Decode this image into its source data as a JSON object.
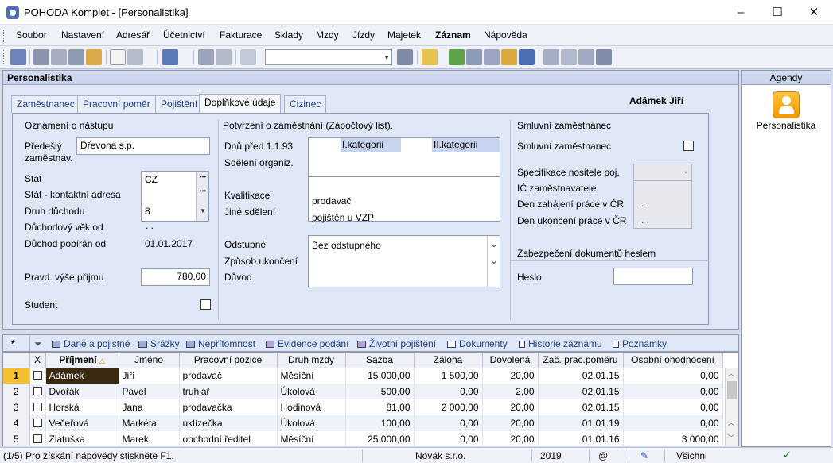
{
  "window": {
    "title": "POHODA Komplet - [Personalistika]",
    "minimize": "–",
    "maximize": "☐",
    "close": "✕"
  },
  "menu": [
    "Soubor",
    "Nastavení",
    "Adresář",
    "Účetnictví",
    "Fakturace",
    "Sklady",
    "Mzdy",
    "Jízdy",
    "Majetek",
    "Záznam",
    "Nápověda"
  ],
  "panel": {
    "title": "Personalistika",
    "tabs": [
      "Zaměstnanec",
      "Pracovní poměr",
      "Pojištění",
      "Doplňkové údaje",
      "Cizinec"
    ],
    "active_tab": "Doplňkové údaje",
    "person_name": "Adámek Jiří"
  },
  "nastup": {
    "section": "Oznámení o nástupu",
    "predesly_label": "Předešlý zaměstnav.",
    "predesly_value": "Dřevona s.p.",
    "stat_label": "Stát",
    "stat_value": "CZ",
    "stat_kontakt_label": "Stát - kontaktní adresa",
    "druh_duchodu_label": "Druh důchodu",
    "druh_duchodu_value": "8",
    "duchodovy_vek_label": "Důchodový věk od",
    "duchodovy_vek_value": " .  .",
    "duchod_od_label": "Důchod pobírán od",
    "duchod_od_value": "01.01.2017",
    "pravd_label": "Pravd. výše příjmu",
    "pravd_value": "780,00",
    "student_label": "Student"
  },
  "potvrzeni": {
    "section": "Potvrzení o zaměstnání (Zápočtový list).",
    "dnu_label": "Dnů před 1.1.93",
    "kat1": "I.kategorii",
    "kat2": "II.kategorii",
    "sdeleni_label": "Sdělení organiz.",
    "kvalifikace_label": "Kvalifikace",
    "kvalifikace_value": "prodavač",
    "jine_label": "Jiné sdělení",
    "jine_value": "pojištěn u VZP",
    "odstupne_label": "Odstupné",
    "odstupne_value": "Bez odstupného",
    "zpusob_label": "Způsob ukončení",
    "duvod_label": "Důvod"
  },
  "smluvni": {
    "section": "Smluvní zaměstnanec",
    "checkbox_label": "Smluvní zaměstnanec",
    "spec_label": "Specifikace nositele poj.",
    "ic_label": "IČ zaměstnavatele",
    "zahajeni_label": "Den zahájení práce v ČR",
    "zahajeni_value": ". .",
    "ukonceni_label": "Den ukončení práce v ČR",
    "ukonceni_value": ". .",
    "zabezpeceni": "Zabezpečení dokumentů heslem",
    "heslo_label": "Heslo"
  },
  "agendy": {
    "title": "Agendy",
    "item": "Personalistika"
  },
  "lower_tabs": [
    "Daně a pojistné",
    "Srážky",
    "Nepřítomnost",
    "Evidence podání",
    "Životní pojištění",
    "Dokumenty",
    "Historie záznamu",
    "Poznámky"
  ],
  "grid": {
    "star": "*",
    "columns": [
      "X",
      "Příjmení",
      "Jméno",
      "Pracovní pozice",
      "Druh mzdy",
      "Sazba",
      "Záloha",
      "Dovolená",
      "Zač. prac.poměru",
      "Osobní ohodnocení"
    ],
    "rows": [
      {
        "n": "1",
        "prijmeni": "Adámek",
        "jmeno": "Jiří",
        "pozice": "prodavač",
        "druh": "Měsíční",
        "sazba": "15 000,00",
        "zaloha": "1 500,00",
        "dovolena": "20,00",
        "zac": "02.01.15",
        "osobni": "0,00"
      },
      {
        "n": "2",
        "prijmeni": "Dvořák",
        "jmeno": "Pavel",
        "pozice": "truhlář",
        "druh": "Úkolová",
        "sazba": "500,00",
        "zaloha": "0,00",
        "dovolena": "2,00",
        "zac": "02.01.15",
        "osobni": "0,00"
      },
      {
        "n": "3",
        "prijmeni": "Horská",
        "jmeno": "Jana",
        "pozice": "prodavačka",
        "druh": "Hodinová",
        "sazba": "81,00",
        "zaloha": "2 000,00",
        "dovolena": "20,00",
        "zac": "02.01.15",
        "osobni": "0,00"
      },
      {
        "n": "4",
        "prijmeni": "Večeřová",
        "jmeno": "Markéta",
        "pozice": "uklízečka",
        "druh": "Úkolová",
        "sazba": "100,00",
        "zaloha": "0,00",
        "dovolena": "20,00",
        "zac": "01.01.19",
        "osobni": "0,00"
      },
      {
        "n": "5",
        "prijmeni": "Zlatuška",
        "jmeno": "Marek",
        "pozice": "obchodní ředitel",
        "druh": "Měsíční",
        "sazba": "25 000,00",
        "zaloha": "0,00",
        "dovolena": "20,00",
        "zac": "01.01.16",
        "osobni": "3 000,00"
      }
    ]
  },
  "status": {
    "help": "(1/5) Pro získání nápovědy stiskněte F1.",
    "company": "Novák s.r.o.",
    "year": "2019",
    "at": "@",
    "filter": "Všichni"
  }
}
